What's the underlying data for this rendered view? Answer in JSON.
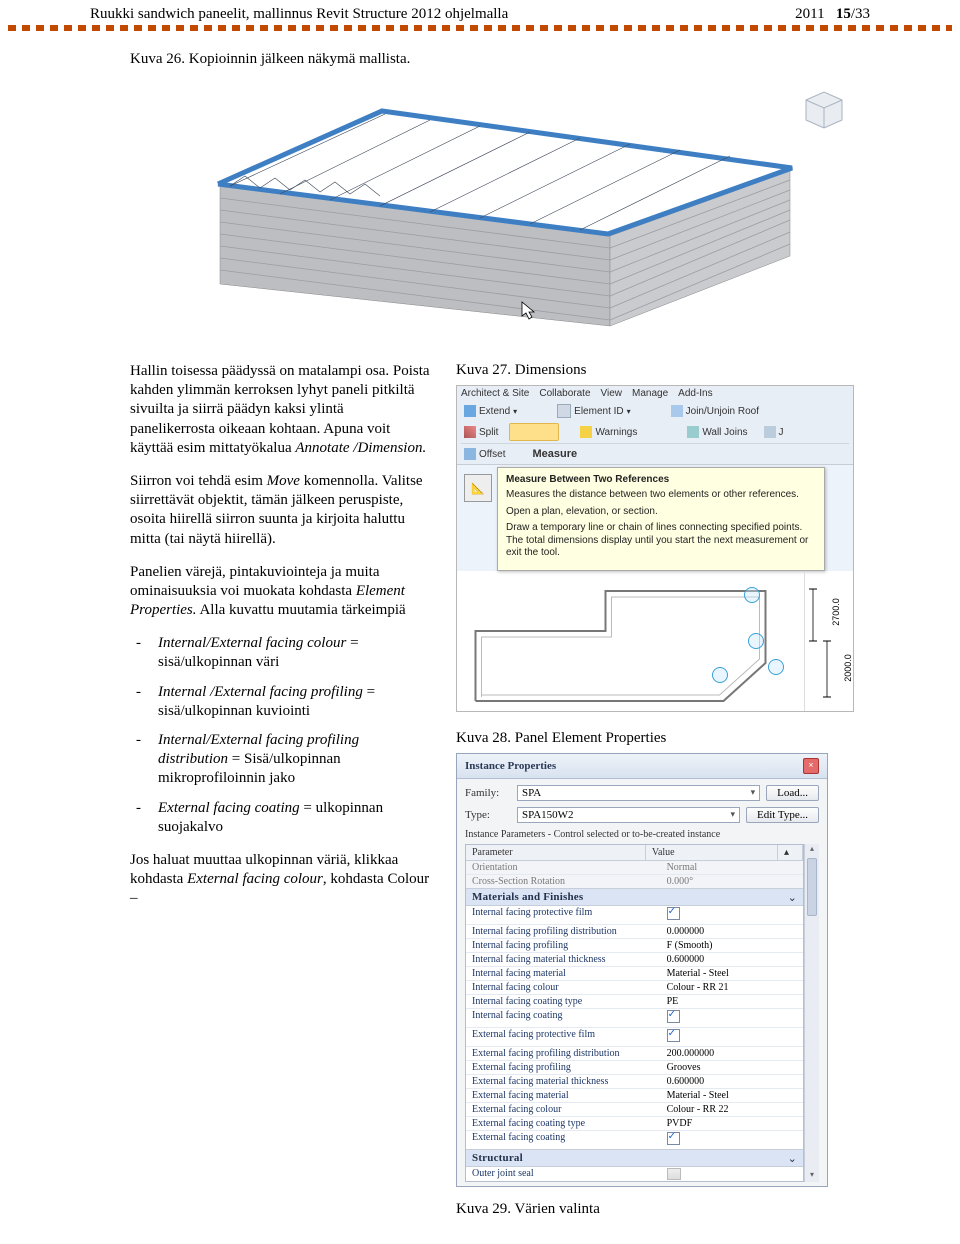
{
  "header": {
    "left": "Ruukki sandwich paneelit, mallinnus Revit Structure 2012 ohjelmalla",
    "year": "2011",
    "page_bold": "15",
    "page_total": "/33"
  },
  "caption_26": "Kuva 26. Kopioinnin jälkeen näkymä mallista.",
  "left_col": {
    "p1": "Hallin toisessa päädyssä on matalampi osa. Poista kahden ylimmän kerroksen lyhyt paneli pitkiltä sivuilta ja siirrä päädyn kaksi ylintä panelikerrosta oikeaan kohtaan. Apuna voit käyttää esim mittatyökalua ",
    "p1_i": "Annotate /Dimension.",
    "p2a": "Siirron voi tehdä esim ",
    "p2_i": "Move",
    "p2b": " komennolla. Valitse siirrettävät objektit, tämän jälkeen peruspiste, osoita hiirellä siirron suunta ja kirjoita haluttu mitta (tai näytä hiirellä).",
    "p3a": "Panelien värejä, pintakuviointeja ja muita ominaisuuksia voi muokata kohdasta ",
    "p3_i1": "Element Properties.",
    "p3b": " Alla kuvattu muutamia tärkeimpiä",
    "bullets": [
      {
        "i": "Internal/External  facing colour",
        "t": " = sisä/ulkopinnan väri"
      },
      {
        "i": "Internal /External facing profiling ",
        "t": " = sisä/ulkopinnan kuviointi"
      },
      {
        "i": "Internal/External facing profiling distribution",
        "t": " = Sisä/ulkopinnan mikroprofiloinnin jako"
      },
      {
        "i": "External facing coating",
        "t": " = ulkopinnan suojakalvo"
      }
    ],
    "p4a": "Jos haluat muuttaa  ulkopinnan väriä, klikkaa kohdasta ",
    "p4_i1": "External facing colour",
    "p4b": ", kohdasta Colour –"
  },
  "right_col": {
    "caption_27": "Kuva 27. Dimensions",
    "caption_28": "Kuva 28. Panel Element Properties",
    "caption_29": "Kuva 29. Värien valinta"
  },
  "dim_shot": {
    "tabs": [
      "Architect & Site",
      "Collaborate",
      "View",
      "Manage",
      "Add-Ins"
    ],
    "row1": {
      "extend": "Extend",
      "eid": "Element ID",
      "join": "Join/Unjoin Roof"
    },
    "row2": {
      "split": "Split",
      "warn": "Warnings",
      "wall": "Wall Joins"
    },
    "row3": {
      "offset": "Offset",
      "measure": "Measure"
    },
    "tooltip": {
      "title": "Measure Between Two References",
      "l1": "Measures the distance between two elements or other references.",
      "l2": "Open a plan, elevation, or section.",
      "l3": "Draw a temporary line or chain of lines connecting specified points. The total dimensions display until you start the next measurement or exit the tool."
    },
    "dimA": "2700.0",
    "dimB": "2000.0"
  },
  "ip": {
    "title": "Instance Properties",
    "family_label": "Family:",
    "family_value": "SPA",
    "type_label": "Type:",
    "type_value": "SPA150W2",
    "load_btn": "Load...",
    "edit_btn": "Edit Type...",
    "sub": "Instance Parameters - Control selected or to-be-created instance",
    "head_param": "Parameter",
    "head_value": "Value",
    "muted_rows": [
      {
        "n": "Orientation",
        "v": "Normal"
      },
      {
        "n": "Cross-Section Rotation",
        "v": "0.000°"
      }
    ],
    "group_mf": "Materials and Finishes",
    "mf_rows": [
      {
        "n": "Internal facing protective film",
        "v": "__chk__"
      },
      {
        "n": "Internal facing profiling distribution",
        "v": "0.000000"
      },
      {
        "n": "Internal facing profiling",
        "v": "F (Smooth)"
      },
      {
        "n": "Internal facing material thickness",
        "v": "0.600000"
      },
      {
        "n": "Internal facing material",
        "v": "Material - Steel"
      },
      {
        "n": "Internal facing colour",
        "v": "Colour - RR 21"
      },
      {
        "n": "Internal facing coating type",
        "v": "PE"
      },
      {
        "n": "Internal facing coating",
        "v": "__chk__"
      },
      {
        "n": "External facing protective film",
        "v": "__chk__"
      },
      {
        "n": "External facing profiling distribution",
        "v": "200.000000"
      },
      {
        "n": "External facing profiling",
        "v": "Grooves"
      },
      {
        "n": "External facing material thickness",
        "v": "0.600000"
      },
      {
        "n": "External facing material",
        "v": "Material - Steel"
      },
      {
        "n": "External facing colour",
        "v": "Colour - RR 22"
      },
      {
        "n": "External facing coating type",
        "v": "PVDF"
      },
      {
        "n": "External facing coating",
        "v": "__chk__"
      }
    ],
    "group_st": "Structural",
    "st_rows": [
      {
        "n": "Outer joint seal",
        "v": "__scroll__"
      }
    ]
  }
}
